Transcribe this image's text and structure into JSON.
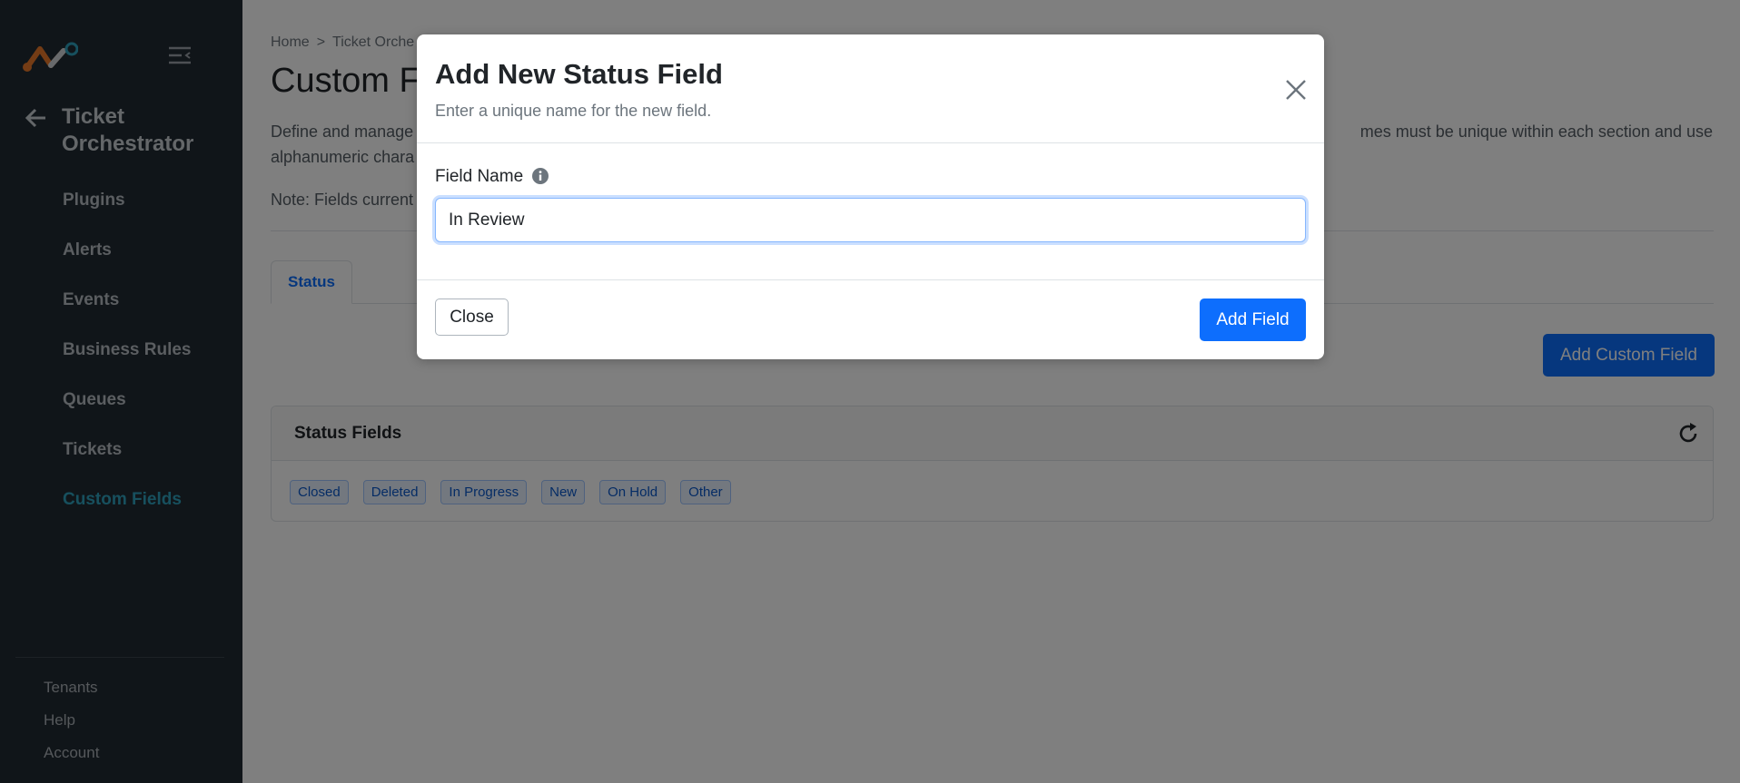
{
  "colors": {
    "sidebar_bg": "#212b33",
    "nav_active": "#2ea0bd",
    "primary": "#0d6efd",
    "badge_bg": "#e7f1ff",
    "badge_text": "#0a58ca"
  },
  "sidebar": {
    "logo_icon": "brand-logo-icon",
    "collapse_icon": "collapse-menu-icon",
    "back_icon": "arrow-left-icon",
    "app_title": "Ticket Orchestrator",
    "nav_items": [
      {
        "label": "Plugins",
        "active": false
      },
      {
        "label": "Alerts",
        "active": false
      },
      {
        "label": "Events",
        "active": false
      },
      {
        "label": "Business Rules",
        "active": false
      },
      {
        "label": "Queues",
        "active": false
      },
      {
        "label": "Tickets",
        "active": false
      },
      {
        "label": "Custom Fields",
        "active": true
      }
    ],
    "footer_items": [
      "Tenants",
      "Help",
      "Account"
    ]
  },
  "main": {
    "breadcrumb": {
      "home": "Home",
      "separator": ">",
      "current": "Ticket Orche"
    },
    "page_title": "Custom Fi",
    "description_line1_start": "Define and manage",
    "description_line1_end": "mes must be unique within each section and use",
    "description_line2": "alphanumeric chara",
    "note": "Note: Fields current",
    "tabs": [
      {
        "label": "Status",
        "active": true
      }
    ],
    "add_custom_field_label": "Add Custom Field",
    "status_card": {
      "title": "Status Fields",
      "refresh_icon": "refresh-icon",
      "badges": [
        "Closed",
        "Deleted",
        "In Progress",
        "New",
        "On Hold",
        "Other"
      ]
    }
  },
  "modal": {
    "title": "Add New Status Field",
    "subtitle": "Enter a unique name for the new field.",
    "close_icon": "close-icon",
    "field_label": "Field Name",
    "info_icon": "info-icon",
    "field_value": "In Review",
    "close_label": "Close",
    "add_label": "Add Field"
  }
}
